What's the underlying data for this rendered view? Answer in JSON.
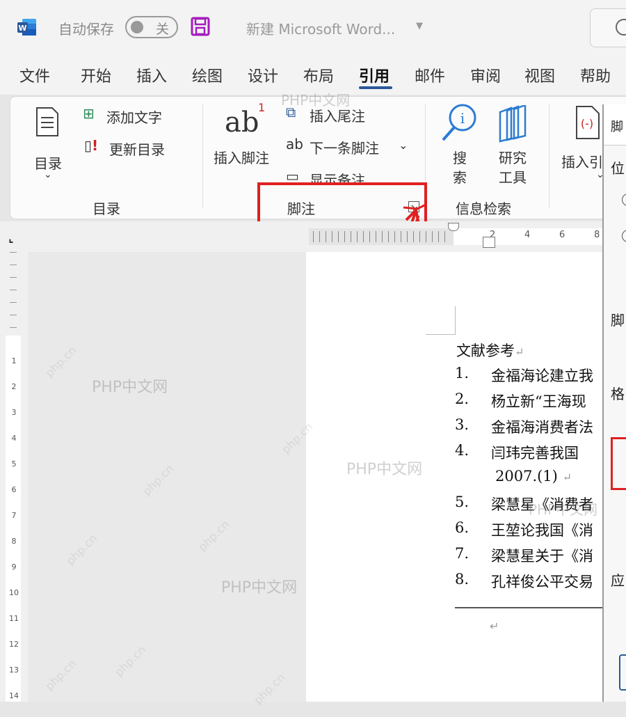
{
  "titlebar": {
    "autosave_label": "自动保存",
    "autosave_state": "关",
    "doc_title": "新建 Microsoft Word..."
  },
  "tabs": [
    "文件",
    "开始",
    "插入",
    "绘图",
    "设计",
    "布局",
    "引用",
    "邮件",
    "审阅",
    "视图",
    "帮助"
  ],
  "active_tab": "引用",
  "ribbon": {
    "toc": {
      "toc_button": "目录",
      "add_text": "添加文字",
      "update_toc": "更新目录",
      "group_label": "目录"
    },
    "footnotes": {
      "insert_footnote": "插入脚注",
      "insert_endnote": "插入尾注",
      "next_footnote": "下一条脚注",
      "show_notes": "显示备注",
      "group_label": "脚注",
      "footnote_superscript": "1"
    },
    "research": {
      "search": [
        "搜",
        "索"
      ],
      "researcher": [
        "研究",
        "工具"
      ],
      "group_label": "信息检索"
    },
    "citations": {
      "insert_citation": "插入引"
    }
  },
  "ruler": {
    "numbers": [
      "2",
      "4",
      "6",
      "8"
    ],
    "left_numbers": [
      "1",
      "2",
      "3",
      "4",
      "5",
      "6",
      "7",
      "8",
      "9",
      "10",
      "11",
      "12",
      "13",
      "14"
    ]
  },
  "document": {
    "heading": "文献参考",
    "references": [
      {
        "num": "1.",
        "text": "金福海论建立我"
      },
      {
        "num": "2.",
        "text": "杨立新“王海现"
      },
      {
        "num": "3.",
        "text": "金福海消费者法"
      },
      {
        "num": "4.",
        "text": "闫玮完善我国"
      },
      {
        "num": "",
        "text": "2007.(1)"
      },
      {
        "num": "5.",
        "text": "梁慧星《消费者"
      },
      {
        "num": "6.",
        "text": "王堃论我国《消"
      },
      {
        "num": "7.",
        "text": "梁慧星关于《消"
      },
      {
        "num": "8.",
        "text": "孔祥俊公平交易"
      }
    ]
  },
  "dialog": {
    "title_fragment": "脚",
    "labels": [
      "位",
      "脚",
      "格",
      "应"
    ]
  },
  "watermarks": [
    "PHP中文网",
    "PHP中文网",
    "PHP中文网",
    "PHP中文网",
    "PHP中文网"
  ],
  "diag_watermark": "php.cn",
  "colors": {
    "highlight_red": "#e02020",
    "word_blue": "#2b579a",
    "active_underline": "#2b579a",
    "save_purple": "#a51bbe"
  }
}
